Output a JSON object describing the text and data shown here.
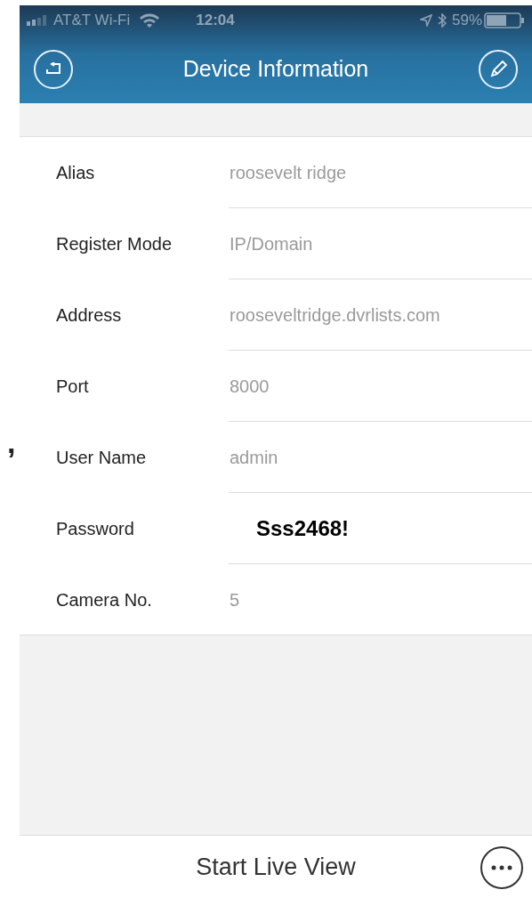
{
  "annotation_mark": ",",
  "status_bar": {
    "carrier": "AT&T Wi-Fi",
    "time": "12:04",
    "battery": "59%"
  },
  "header": {
    "title": "Device Information"
  },
  "fields": [
    {
      "label": "Alias",
      "value": "roosevelt ridge",
      "kind": "plain"
    },
    {
      "label": "Register Mode",
      "value": "IP/Domain",
      "kind": "plain"
    },
    {
      "label": "Address",
      "value": "rooseveltridge.dvrlists.com",
      "kind": "plain"
    },
    {
      "label": "Port",
      "value": "8000",
      "kind": "plain"
    },
    {
      "label": "User Name",
      "value": "admin",
      "kind": "plain"
    },
    {
      "label": "Password",
      "value": "Sss2468!",
      "kind": "overlay"
    },
    {
      "label": "Camera No.",
      "value": "5",
      "kind": "plain"
    }
  ],
  "bottom_bar": {
    "button": "Start Live View"
  }
}
